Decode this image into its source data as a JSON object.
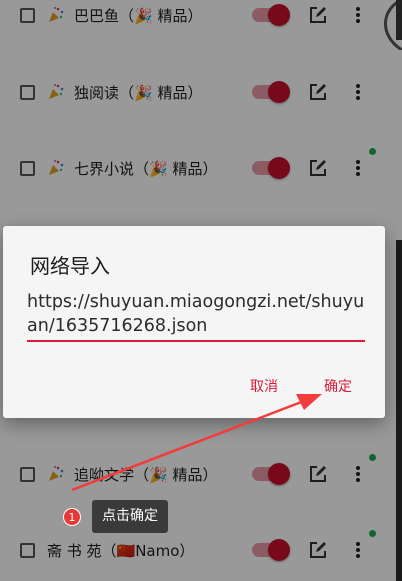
{
  "rows": [
    {
      "name": "巴巴鱼（",
      "tag": "精品）",
      "enabled": true
    },
    {
      "name": "独阅读（",
      "tag": "精品）",
      "enabled": true
    },
    {
      "name": "七界小说（",
      "tag": "精品）",
      "enabled": true
    },
    {
      "name": "追呦文学（",
      "tag": "精品）",
      "enabled": true
    },
    {
      "name": "斋 书 苑（🇨🇳Namo）",
      "tag": "",
      "enabled": true
    }
  ],
  "dialog": {
    "title": "网络导入",
    "url": "https://shuyuan.miaogongzi.net/shuyuan/1635716268.json",
    "cancel_label": "取消",
    "ok_label": "确定"
  },
  "tooltip": {
    "step": "1",
    "text": "点击确定"
  },
  "colors": {
    "accent": "#d81b3c",
    "status_dot": "#1ea84a"
  }
}
